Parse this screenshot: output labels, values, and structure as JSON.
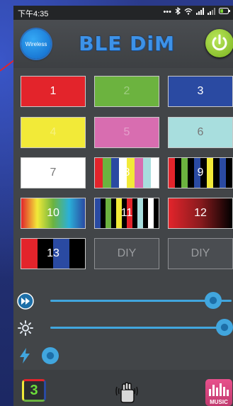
{
  "status_bar": {
    "time": "下午4:35",
    "icons": [
      "dots-icon",
      "bluetooth-icon",
      "wifi-icon",
      "signal-icon",
      "signal-icon",
      "battery-icon"
    ]
  },
  "header": {
    "wireless_label": "Wireless",
    "title": "BLE DiM"
  },
  "tiles": [
    {
      "label": "1",
      "style": "solid",
      "colors": [
        "#e3242b"
      ]
    },
    {
      "label": "2",
      "style": "solid-dim",
      "colors": [
        "#6cb33f"
      ]
    },
    {
      "label": "3",
      "style": "solid",
      "colors": [
        "#2a4aa2"
      ]
    },
    {
      "label": "4",
      "style": "solid-dim",
      "colors": [
        "#f2ea38"
      ]
    },
    {
      "label": "5",
      "style": "solid-dim",
      "colors": [
        "#d86db0"
      ]
    },
    {
      "label": "6",
      "style": "solid-dark",
      "colors": [
        "#a8dede"
      ]
    },
    {
      "label": "7",
      "style": "solid-dark",
      "colors": [
        "#ffffff"
      ]
    },
    {
      "label": "8",
      "style": "stripes",
      "colors": [
        "#e3242b",
        "#6cb33f",
        "#2a4aa2",
        "#ffffff",
        "#f2ea38",
        "#d86db0",
        "#a8dede",
        "#ffffff"
      ]
    },
    {
      "label": "9",
      "style": "stripes",
      "colors": [
        "#e3242b",
        "#000000",
        "#6cb33f",
        "#000000",
        "#2a4aa2",
        "#000000",
        "#f2ea38",
        "#000000",
        "#2a4aa2",
        "#000000"
      ]
    },
    {
      "label": "10",
      "style": "gradient",
      "colors": [
        "#e3242b",
        "#f2ea38",
        "#6cb33f",
        "#2ab0d8",
        "#2a4aa2"
      ]
    },
    {
      "label": "11",
      "style": "stripes",
      "colors": [
        "#2a4aa2",
        "#000",
        "#6cb33f",
        "#000",
        "#f2ea38",
        "#000",
        "#e3242b",
        "#000",
        "#a8dede",
        "#000",
        "#ffffff",
        "#000"
      ]
    },
    {
      "label": "12",
      "style": "gradient",
      "colors": [
        "#e3242b",
        "#8a1b1e",
        "#000000"
      ]
    },
    {
      "label": "13",
      "style": "stripes",
      "colors": [
        "#e3242b",
        "#000000",
        "#2a4aa2",
        "#000000"
      ]
    },
    {
      "label": "DIY",
      "style": "diy",
      "colors": []
    },
    {
      "label": "DIY",
      "style": "diy",
      "colors": []
    }
  ],
  "sliders": {
    "speed": {
      "icon": "fast-forward-icon",
      "value": 0.9
    },
    "brightness": {
      "icon": "brightness-icon",
      "value": 1.0
    },
    "sensitivity": {
      "icon": "lightning-icon",
      "value": 0.0
    }
  },
  "bottom_bar": {
    "mode_number": "3",
    "music_label": "MUSIC"
  },
  "colors": {
    "accent_blue": "#41a6de",
    "power_green": "#8cc230"
  }
}
